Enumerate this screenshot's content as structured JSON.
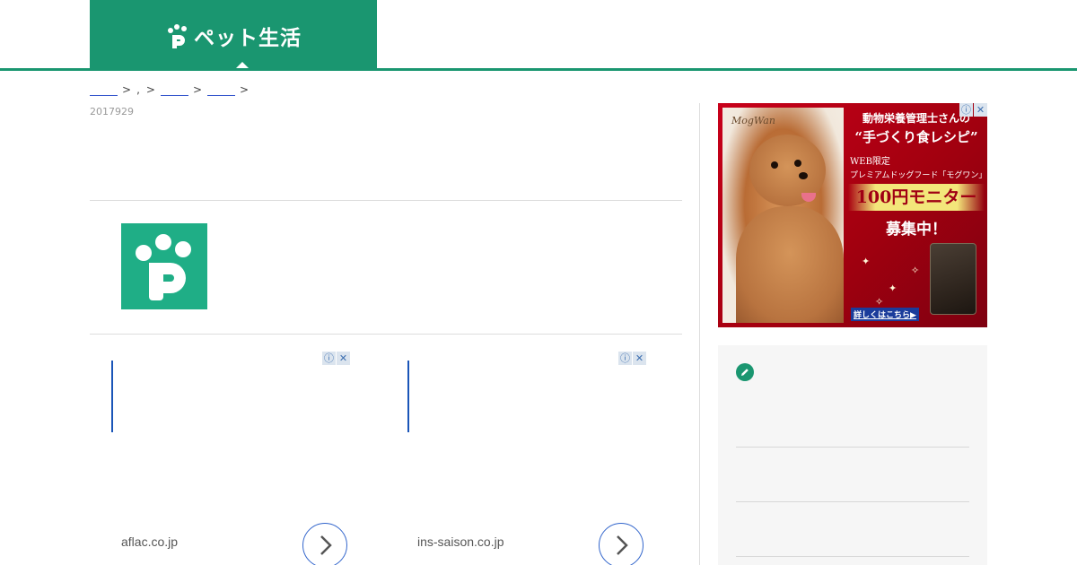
{
  "header": {
    "logo_text": "ペット生活",
    "brand_color": "#1a9670"
  },
  "breadcrumb": {
    "separator": ">",
    "dot": ","
  },
  "post": {
    "date": "2017929"
  },
  "author": {
    "avatar_icon": "paw-p-logo-icon"
  },
  "ads": [
    {
      "domain": "aflac.co.jp",
      "arrow_icon": "chevron-right-icon"
    },
    {
      "domain": "ins-saison.co.jp",
      "arrow_icon": "chevron-right-icon"
    }
  ],
  "ad_choices": {
    "info_glyph": "ⓘ",
    "close_glyph": "✕"
  },
  "sidebar_ad": {
    "brand": "MogWan",
    "line1": "動物栄養管理士さんの",
    "line2": "“手づくり食レシピ”",
    "line3": "WEB限定",
    "line4": "プレミアムドッグフード「モグワン」",
    "line5": "100円モニター",
    "line6": "募集中！",
    "link_text": "詳しくはこちら▶",
    "bg_color": "#c8001a"
  },
  "sidebar_panel": {
    "icon": "pencil-icon",
    "bg_color": "#f6f6f6"
  }
}
